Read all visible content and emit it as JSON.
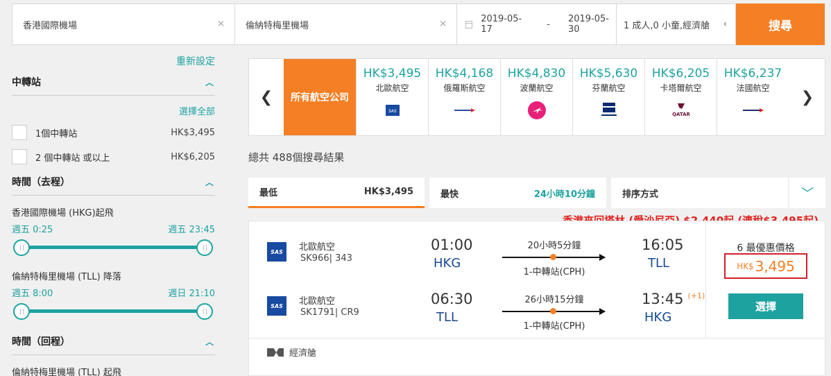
{
  "search": {
    "from": "香港國際機場",
    "to": "倫納特梅里機場",
    "depart_date": "2019-05-17",
    "date_sep": "-",
    "return_date": "2019-05-30",
    "passengers": "1 成人,0 小童,經濟艙",
    "button": "搜尋"
  },
  "sidebar": {
    "reset": "重新設定",
    "stops": {
      "title": "中轉站",
      "select_all": "選擇全部",
      "options": [
        {
          "label": "1個中轉站",
          "price": "HK$3,495"
        },
        {
          "label": "2 個中轉站 或以上",
          "price": "HK$6,205"
        }
      ]
    },
    "outbound": {
      "title": "時間（去程）",
      "depart_label": "香港國際機場 (HKG)起飛",
      "depart_from": "週五 0:25",
      "depart_to": "週五 23:45",
      "arrive_label": "倫納特梅里機場 (TLL) 降落",
      "arrive_from": "週五 8:00",
      "arrive_to": "週日 21:10"
    },
    "inbound": {
      "title": "時間（回程）",
      "depart_label": "倫納特梅里機場 (TLL) 起飛"
    }
  },
  "airlines": {
    "all_label": "所有航空公司",
    "items": [
      {
        "price": "HK$3,495",
        "name": "北歐航空"
      },
      {
        "price": "HK$4,168",
        "name": "俄羅斯航空"
      },
      {
        "price": "HK$4,830",
        "name": "波蘭航空"
      },
      {
        "price": "HK$5,630",
        "name": "芬蘭航空"
      },
      {
        "price": "HK$6,205",
        "name": "卡塔爾航空"
      },
      {
        "price": "HK$6,237",
        "name": "法國航空"
      }
    ],
    "logo_text": {
      "sas": "SAS",
      "qatar": "QATAR"
    }
  },
  "results": {
    "total": "總共 488個搜尋結果"
  },
  "sort": {
    "cheapest_label": "最低",
    "cheapest_value": "HK$3,495",
    "fastest_label": "最快",
    "fastest_value": "24小時10分鐘",
    "sort_label": "排序方式"
  },
  "promo": "香港來回塔林 (愛沙尼亞) $2,440起 (連稅$3,495起)",
  "result": {
    "outbound": {
      "airline": "北歐航空",
      "flight": "SK966| 343",
      "depart_time": "01:00",
      "depart_code": "HKG",
      "duration": "20小時5分鐘",
      "stops": "1-中轉站(CPH)",
      "arrive_time": "16:05",
      "arrive_code": "TLL"
    },
    "inbound": {
      "airline": "北歐航空",
      "flight": "SK1791| CR9",
      "depart_time": "06:30",
      "depart_code": "TLL",
      "duration": "26小時15分鐘",
      "stops": "1-中轉站(CPH)",
      "arrive_time": "13:45",
      "plus_day": "(+1)",
      "arrive_code": "HKG"
    },
    "deals_label": "6 最優惠價格",
    "currency": "HK$",
    "price": "3,495",
    "select_button": "選擇",
    "cabin": "經濟艙",
    "logo_text": "SAS"
  },
  "colors": {
    "accent_orange": "#f57f24",
    "teal": "#1ea2a0",
    "promo_red": "#e0221f",
    "price_border": "#d0202a"
  }
}
